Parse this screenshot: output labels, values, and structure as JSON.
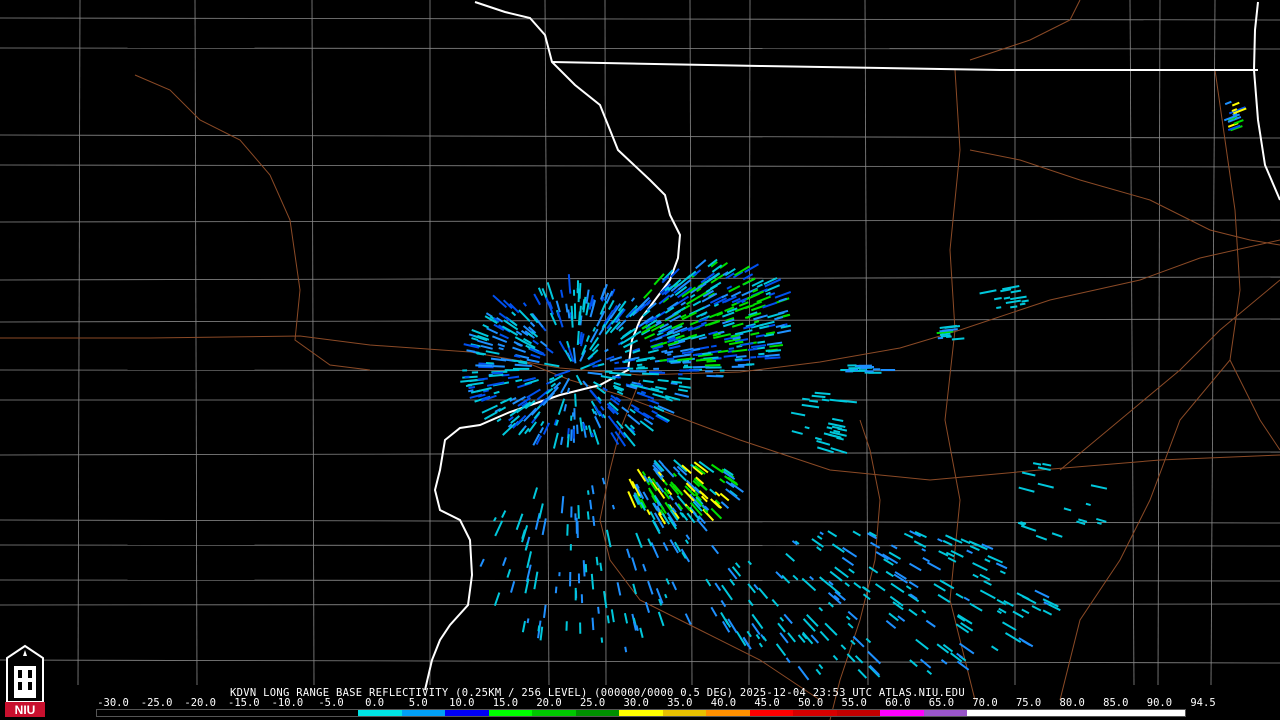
{
  "header": {
    "title": "KDVN LONG RANGE BASE REFLECTIVITY (0.25KM / 256 LEVEL) (000000/0000 0.5 DEG) 2025-12-04 23:53 UTC  ATLAS.NIU.EDU"
  },
  "logo": {
    "icon": "niu-logo-icon",
    "text": "NIU",
    "color": "#c8102e"
  },
  "legend": {
    "ticks": [
      "-30.0",
      "-25.0",
      "-20.0",
      "-15.0",
      "-10.0",
      "-5.0",
      "0.0",
      "5.0",
      "10.0",
      "15.0",
      "20.0",
      "25.0",
      "30.0",
      "35.0",
      "40.0",
      "45.0",
      "50.0",
      "55.0",
      "60.0",
      "65.0",
      "70.0",
      "75.0",
      "80.0",
      "85.0",
      "90.0",
      "94.5"
    ],
    "colors": [
      "#000000",
      "#000000",
      "#000000",
      "#000000",
      "#000000",
      "#000000",
      "#00e4e4",
      "#01a0f6",
      "#0000f6",
      "#00ff00",
      "#00c800",
      "#009000",
      "#ffff00",
      "#e7c000",
      "#ff9000",
      "#ff0000",
      "#d60000",
      "#c00000",
      "#ff00ff",
      "#9955c9",
      "#ffffff",
      "#ffffff",
      "#ffffff",
      "#ffffff",
      "#ffffff"
    ]
  },
  "map": {
    "county_line_color": "#8a8a8a",
    "state_line_color": "#ffffff",
    "road_color": "#8b4a26",
    "echo_colors": [
      "#00c8dc",
      "#1e90ff",
      "#0050f0",
      "#00e000",
      "#ffff00"
    ]
  }
}
